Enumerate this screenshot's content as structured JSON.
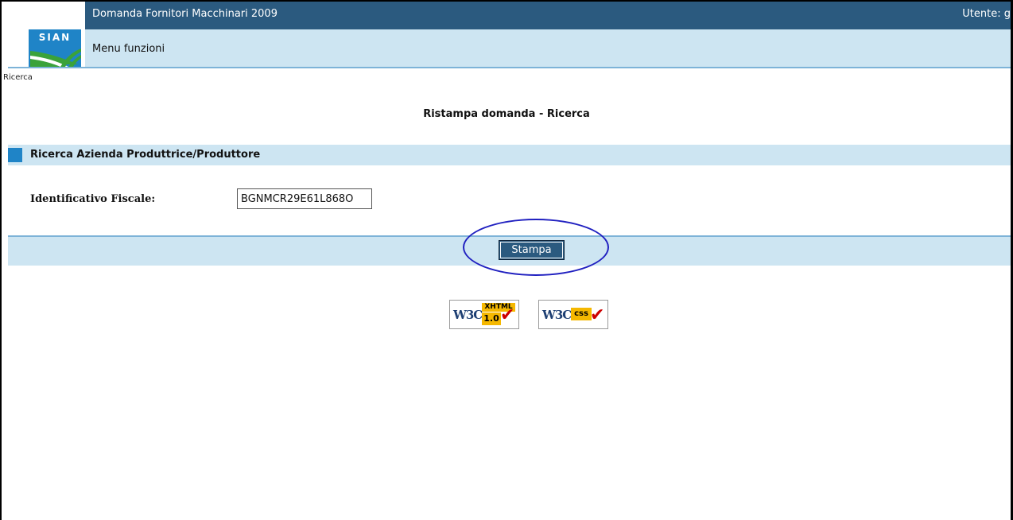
{
  "header": {
    "app_title": "Domanda Fornitori Macchinari 2009",
    "menu_link": "Menu funzioni",
    "user_label": "Utente: g",
    "logo_text": "SIAN"
  },
  "breadcrumb": "Ricerca",
  "page_title": "Ristampa domanda - Ricerca",
  "section": {
    "title": "Ricerca Azienda Produttrice/Produttore"
  },
  "form": {
    "fiscal_id_label": "Identificativo Fiscale:",
    "fiscal_id_value": "BGNMCR29E61L868O"
  },
  "actions": {
    "print_label": "Stampa"
  },
  "badges": {
    "xhtml": {
      "w3c": "W3C",
      "tag_top": "XHTML",
      "tag_bottom": "1.0"
    },
    "css": {
      "w3c": "W3C",
      "tag": "css"
    }
  },
  "colors": {
    "header_dark": "#2b5a7f",
    "header_light": "#cde5f2",
    "accent_blue": "#1f84c7",
    "highlight_ring": "#2020c0"
  }
}
